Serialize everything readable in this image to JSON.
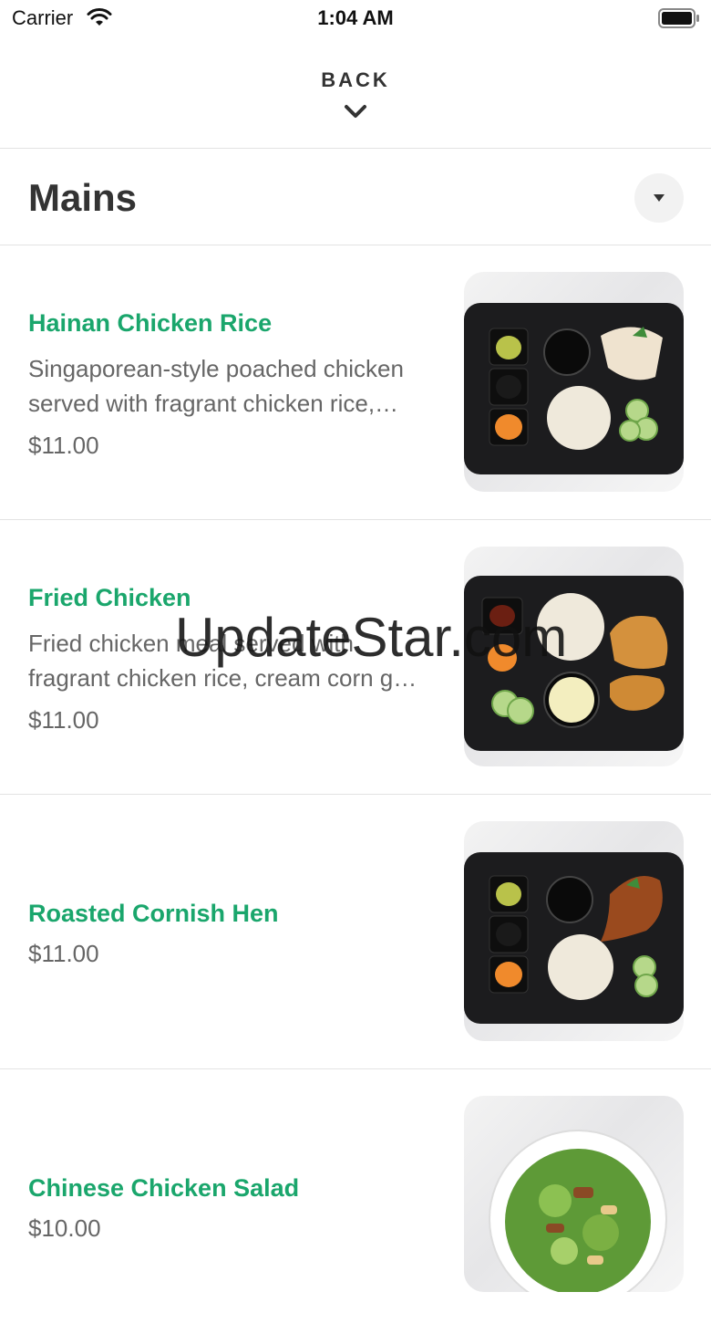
{
  "status_bar": {
    "carrier": "Carrier",
    "time": "1:04 AM"
  },
  "nav": {
    "back_label": "BACK"
  },
  "section": {
    "title": "Mains"
  },
  "items": [
    {
      "name": "Hainan Chicken Rice",
      "description": "Singaporean-style poached chicken served with fragrant chicken rice,…",
      "price": "$11.00",
      "photo": "hainan-chicken-rice-photo"
    },
    {
      "name": "Fried Chicken",
      "description": "Fried chicken meal served with fragrant chicken rice, cream corn g…",
      "price": "$11.00",
      "photo": "fried-chicken-photo"
    },
    {
      "name": "Roasted Cornish Hen",
      "description": "",
      "price": "$11.00",
      "photo": "roasted-cornish-hen-photo"
    },
    {
      "name": "Chinese Chicken Salad",
      "description": "",
      "price": "$10.00",
      "photo": "chinese-chicken-salad-photo"
    }
  ],
  "watermark": "UpdateStar.com",
  "colors": {
    "accent": "#1aa66c",
    "text": "#333333",
    "muted": "#666666",
    "divider": "#e3e3e3"
  }
}
